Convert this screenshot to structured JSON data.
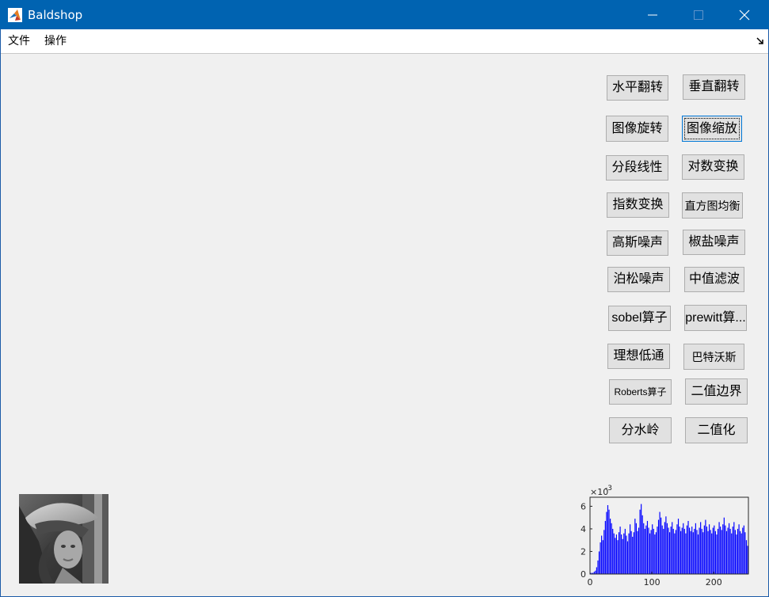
{
  "window": {
    "title": "Baldshop",
    "icon": "matlab-logo-icon"
  },
  "menu": {
    "file": "文件",
    "operations": "操作",
    "dock_icon": "undock-arrow-icon"
  },
  "buttons": {
    "flip_h": "水平翻转",
    "flip_v": "垂直翻转",
    "rotate": "图像旋转",
    "scale": "图像缩放",
    "piecewise": "分段线性",
    "log_transform": "对数变换",
    "exp_transform": "指数变换",
    "hist_eq": "直方图均衡",
    "gauss_noise": "高斯噪声",
    "salt_pepper": "椒盐噪声",
    "poisson_noise": "泊松噪声",
    "median_filter": "中值滤波",
    "sobel": "sobel算子",
    "prewitt": "prewitt算...",
    "ideal_lowpass": "理想低通",
    "butterworth": "巴特沃斯",
    "roberts": "Roberts算子",
    "binary_edge": "二值边界",
    "watershed": "分水岭",
    "binarize": "二值化"
  },
  "image_preview": {
    "icon": "grayscale-portrait-thumbnail"
  },
  "chart_data": {
    "type": "bar",
    "title": "",
    "xlabel": "",
    "ylabel": "",
    "y_exponent_label": "×10",
    "y_exponent_power": "-3",
    "xlim": [
      0,
      256
    ],
    "ylim": [
      0,
      0.0068
    ],
    "x_ticks": [
      "0",
      "100",
      "200"
    ],
    "y_ticks": [
      "0",
      "2",
      "4",
      "6"
    ],
    "bar_color": "#0000ff",
    "grid": false,
    "x": [
      0,
      2,
      4,
      6,
      8,
      10,
      12,
      14,
      16,
      18,
      20,
      22,
      24,
      26,
      28,
      30,
      32,
      34,
      36,
      38,
      40,
      42,
      44,
      46,
      48,
      50,
      52,
      54,
      56,
      58,
      60,
      62,
      64,
      66,
      68,
      70,
      72,
      74,
      76,
      78,
      80,
      82,
      84,
      86,
      88,
      90,
      92,
      94,
      96,
      98,
      100,
      102,
      104,
      106,
      108,
      110,
      112,
      114,
      116,
      118,
      120,
      122,
      124,
      126,
      128,
      130,
      132,
      134,
      136,
      138,
      140,
      142,
      144,
      146,
      148,
      150,
      152,
      154,
      156,
      158,
      160,
      162,
      164,
      166,
      168,
      170,
      172,
      174,
      176,
      178,
      180,
      182,
      184,
      186,
      188,
      190,
      192,
      194,
      196,
      198,
      200,
      202,
      204,
      206,
      208,
      210,
      212,
      214,
      216,
      218,
      220,
      222,
      224,
      226,
      228,
      230,
      232,
      234,
      236,
      238,
      240,
      242,
      244,
      246,
      248,
      250,
      252,
      254
    ],
    "values": [
      0.0001,
      0.0001,
      0.0001,
      0.0002,
      0.0003,
      0.0006,
      0.0012,
      0.002,
      0.0028,
      0.0034,
      0.003,
      0.0039,
      0.0047,
      0.0055,
      0.0061,
      0.0057,
      0.0049,
      0.0045,
      0.004,
      0.0036,
      0.0032,
      0.0035,
      0.003,
      0.0037,
      0.0042,
      0.0035,
      0.0031,
      0.0036,
      0.004,
      0.0034,
      0.0029,
      0.0036,
      0.0044,
      0.0038,
      0.0033,
      0.0037,
      0.0049,
      0.0045,
      0.0038,
      0.0041,
      0.0057,
      0.0062,
      0.0052,
      0.0045,
      0.004,
      0.0043,
      0.0047,
      0.0041,
      0.0036,
      0.0039,
      0.0044,
      0.004,
      0.0035,
      0.0037,
      0.0042,
      0.0048,
      0.0055,
      0.005,
      0.0043,
      0.004,
      0.0046,
      0.0051,
      0.0045,
      0.0041,
      0.0037,
      0.0042,
      0.0046,
      0.004,
      0.0036,
      0.0039,
      0.0044,
      0.0049,
      0.0042,
      0.0038,
      0.0041,
      0.0045,
      0.004,
      0.0036,
      0.0043,
      0.0047,
      0.0041,
      0.0038,
      0.0042,
      0.0037,
      0.004,
      0.0045,
      0.0039,
      0.0035,
      0.0041,
      0.0046,
      0.004,
      0.0037,
      0.0043,
      0.0048,
      0.0042,
      0.0038,
      0.0044,
      0.0039,
      0.0036,
      0.0041,
      0.0043,
      0.0038,
      0.0035,
      0.004,
      0.0046,
      0.0042,
      0.0039,
      0.0044,
      0.005,
      0.0043,
      0.0038,
      0.0041,
      0.0045,
      0.004,
      0.0036,
      0.0042,
      0.0046,
      0.0039,
      0.0035,
      0.004,
      0.0044,
      0.0038,
      0.0036,
      0.0041,
      0.0043,
      0.0037,
      0.003,
      0.0025
    ]
  }
}
